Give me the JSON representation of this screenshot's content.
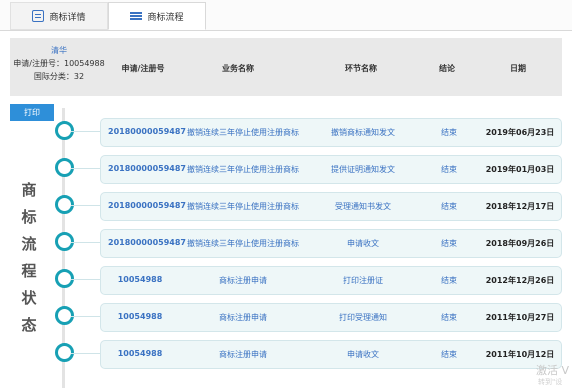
{
  "tabs": [
    {
      "label": "商标详情",
      "icon": "document-icon"
    },
    {
      "label": "商标流程",
      "icon": "list-icon"
    }
  ],
  "summary": {
    "name": "清华",
    "reg_line": "申请/注册号：10054988",
    "class_line": "国际分类：32"
  },
  "table": {
    "columns": [
      "申请/注册号",
      "业务名称",
      "环节名称",
      "结论",
      "日期"
    ],
    "rows": [
      {
        "reg": "20180000059487",
        "business": "撤销连续三年停止使用注册商标",
        "step": "撤销商标通知发文",
        "result": "结束",
        "date": "2019年06月23日"
      },
      {
        "reg": "20180000059487",
        "business": "撤销连续三年停止使用注册商标",
        "step": "提供证明通知发文",
        "result": "结束",
        "date": "2019年01月03日"
      },
      {
        "reg": "20180000059487",
        "business": "撤销连续三年停止使用注册商标",
        "step": "受理通知书发文",
        "result": "结束",
        "date": "2018年12月17日"
      },
      {
        "reg": "20180000059487",
        "business": "撤销连续三年停止使用注册商标",
        "step": "申请收文",
        "result": "结束",
        "date": "2018年09月26日"
      },
      {
        "reg": "10054988",
        "business": "商标注册申请",
        "step": "打印注册证",
        "result": "结束",
        "date": "2012年12月26日"
      },
      {
        "reg": "10054988",
        "business": "商标注册申请",
        "step": "打印受理通知",
        "result": "结束",
        "date": "2011年10月27日"
      },
      {
        "reg": "10054988",
        "business": "商标注册申请",
        "step": "申请收文",
        "result": "结束",
        "date": "2011年10月12日"
      }
    ]
  },
  "print_label": "打印",
  "side_title": [
    "商",
    "标",
    "流",
    "程",
    "状",
    "态"
  ],
  "watermark": {
    "line1": "激活 V",
    "line2": "转到\"设"
  },
  "colors": {
    "accent": "#17a0b4",
    "link": "#3a72c2",
    "button": "#2e8fd9"
  }
}
